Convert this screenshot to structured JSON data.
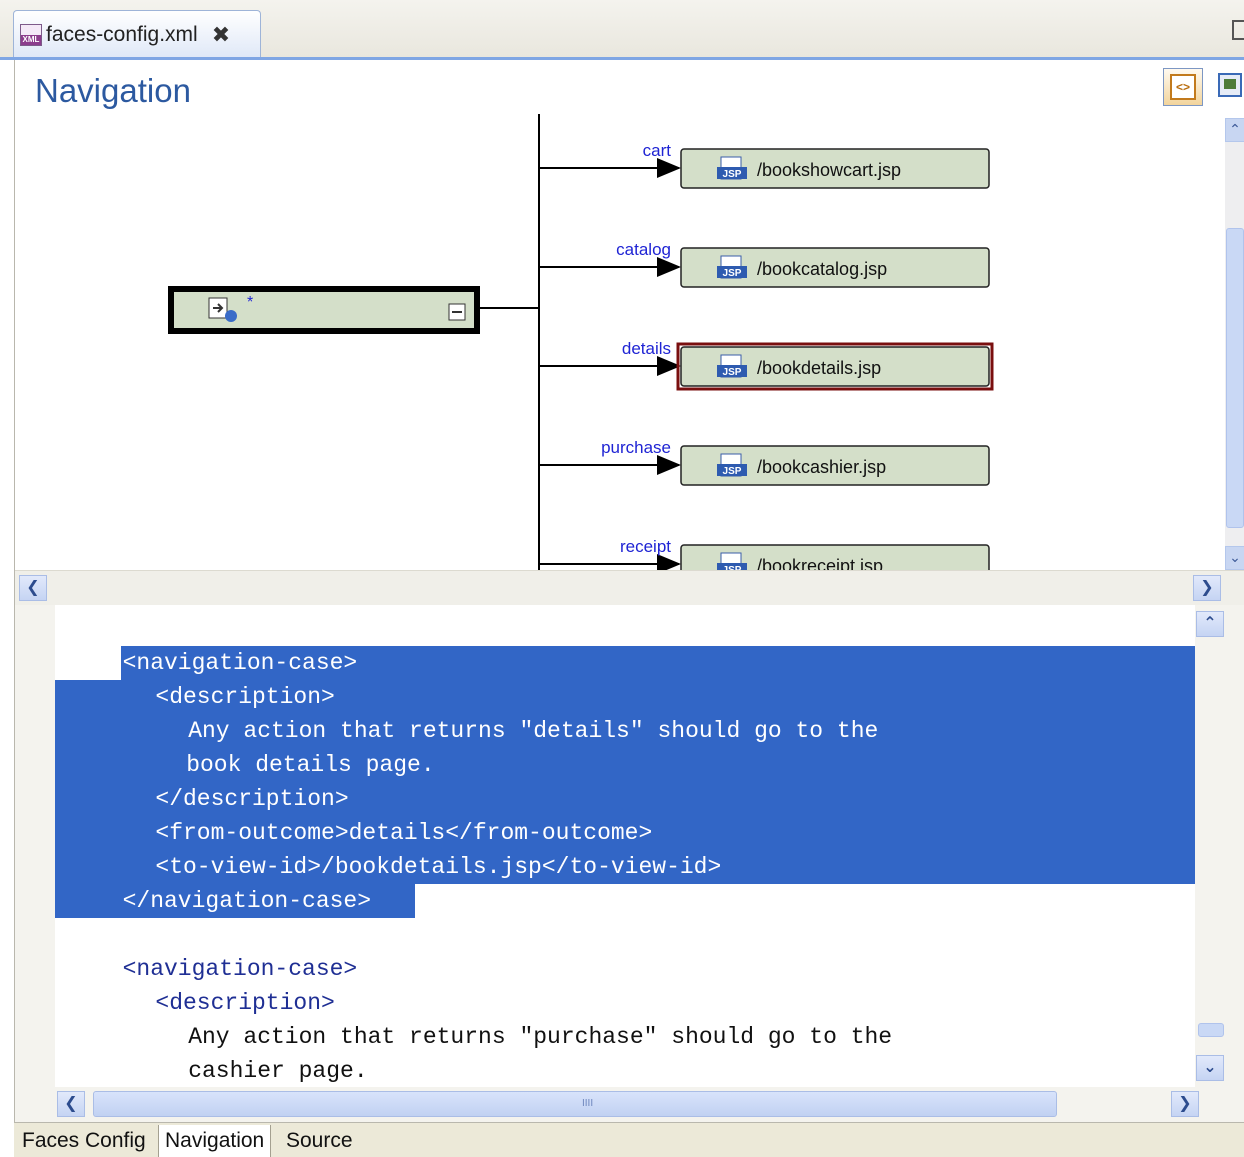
{
  "editor_tab": {
    "title": "faces-config.xml",
    "icon": "xml-file-icon",
    "close": "✖"
  },
  "pane": {
    "title": "Navigation"
  },
  "toolbar": {
    "source_toggle_icon": "source-view-icon",
    "diagram_toggle_icon": "diagram-view-icon"
  },
  "diagram": {
    "from_view": {
      "label": "*",
      "icon": "page-flow-icon",
      "collapse": "−"
    },
    "cases": [
      {
        "outcome": "cart",
        "target": "/bookshowcart.jsp",
        "icon": "jsp-file-icon"
      },
      {
        "outcome": "catalog",
        "target": "/bookcatalog.jsp",
        "icon": "jsp-file-icon"
      },
      {
        "outcome": "details",
        "target": "/bookdetails.jsp",
        "icon": "jsp-file-icon",
        "selected": true
      },
      {
        "outcome": "purchase",
        "target": "/bookcashier.jsp",
        "icon": "jsp-file-icon"
      },
      {
        "outcome": "receipt",
        "target": "/bookreceipt.jsp",
        "icon": "jsp-file-icon"
      }
    ],
    "colors": {
      "node_fill": "#d4dfc9",
      "edge": "#000000",
      "label": "#1f24d4",
      "selected_border": "#7a0f0f"
    }
  },
  "source": {
    "lines": [
      {
        "text": "<navigation-case>",
        "indent": 2,
        "highlight": true
      },
      {
        "text": "<description>",
        "indent": 3,
        "highlight": true
      },
      {
        "text": "Any action that returns \"details\" should go to the",
        "indent": 4,
        "highlight": true
      },
      {
        "text": "book details page.",
        "indent": 4,
        "highlight": true
      },
      {
        "text": "</description>",
        "indent": 3,
        "highlight": true
      },
      {
        "text": "<from-outcome>details</from-outcome>",
        "indent": 3,
        "highlight": true
      },
      {
        "text": "<to-view-id>/bookdetails.jsp</to-view-id>",
        "indent": 3,
        "highlight": true
      },
      {
        "text": "</navigation-case>",
        "indent": 2,
        "highlight": true
      },
      {
        "text": "",
        "indent": 0,
        "highlight": false
      },
      {
        "text": "<navigation-case>",
        "indent": 2,
        "highlight": false
      },
      {
        "text": "<description>",
        "indent": 3,
        "highlight": false
      },
      {
        "text": "Any action that returns \"purchase\" should go to the",
        "indent": 4,
        "highlight": false
      },
      {
        "text": "cashier page.",
        "indent": 4,
        "highlight": false
      }
    ],
    "selection_color": "#3266c6"
  },
  "bottom_tabs": [
    {
      "label": "Faces Config",
      "active": false
    },
    {
      "label": "Navigation",
      "active": true
    },
    {
      "label": "Source",
      "active": false
    }
  ],
  "scroll": {
    "left": "❮",
    "right": "❯",
    "up": "⌃",
    "down": "⌄",
    "grip": "IIII"
  }
}
